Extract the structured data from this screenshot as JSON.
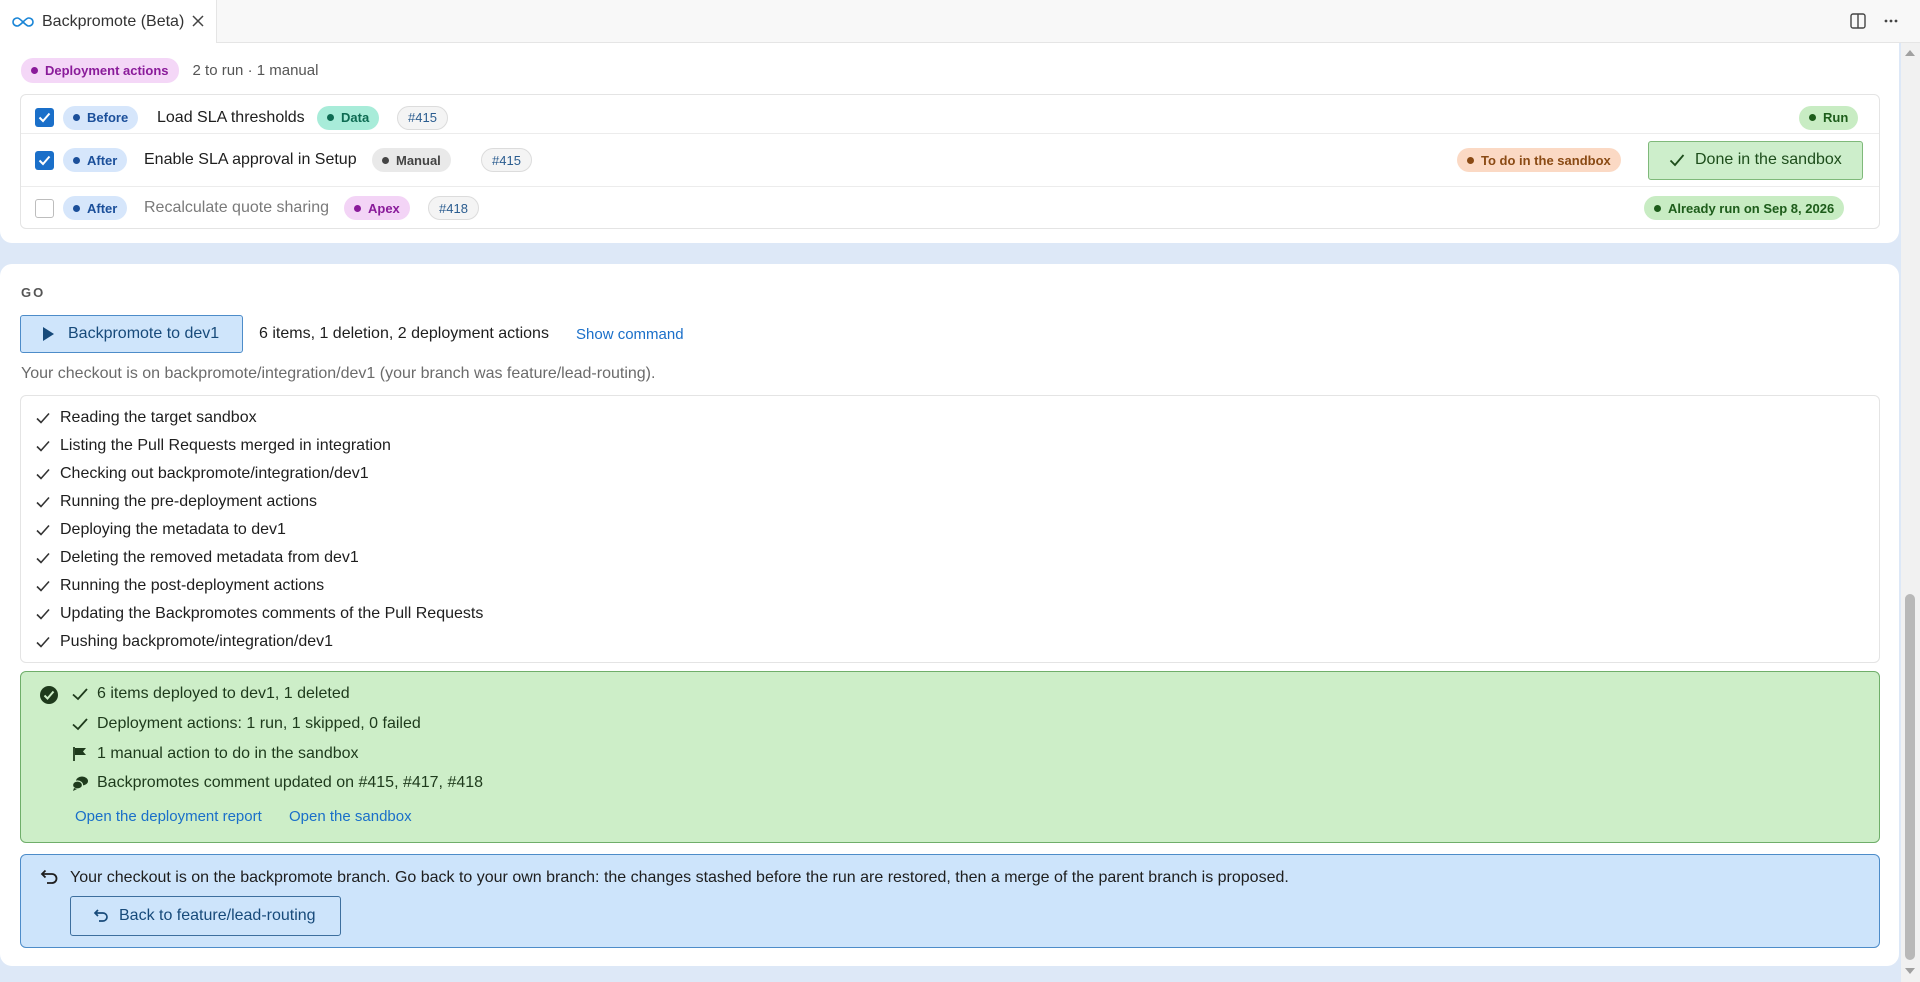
{
  "tab": {
    "title": "Backpromote (Beta)"
  },
  "deployment_actions": {
    "label": "Deployment actions",
    "summary": "2 to run · 1 manual",
    "rows": [
      {
        "checked": true,
        "phase": "Before",
        "title": "Load SLA thresholds",
        "kind": "Data",
        "pr": "#415",
        "status": "Run"
      },
      {
        "checked": true,
        "phase": "After",
        "title": "Enable SLA approval in Setup",
        "kind": "Manual",
        "pr": "#415",
        "status": "To do in the sandbox",
        "button": "Done in the sandbox"
      },
      {
        "checked": false,
        "phase": "After",
        "title": "Recalculate quote sharing",
        "kind": "Apex",
        "pr": "#418",
        "status": "Already run on Sep 8, 2026"
      }
    ]
  },
  "go": {
    "label": "GO",
    "button": "Backpromote to dev1",
    "summary": "6 items, 1 deletion, 2 deployment actions",
    "show_command": "Show command",
    "checkout_note": "Your checkout is on backpromote/integration/dev1 (your branch was feature/lead-routing).",
    "steps": [
      "Reading the target sandbox",
      "Listing the Pull Requests merged in integration",
      "Checking out backpromote/integration/dev1",
      "Running the pre-deployment actions",
      "Deploying the metadata to dev1",
      "Deleting the removed metadata from dev1",
      "Running the post-deployment actions",
      "Updating the Backpromotes comments of the Pull Requests",
      "Pushing backpromote/integration/dev1"
    ]
  },
  "result": {
    "lines": [
      "6 items deployed to dev1, 1 deleted",
      "Deployment actions: 1 run, 1 skipped, 0 failed",
      "1 manual action to do in the sandbox",
      "Backpromotes comment updated on #415, #417, #418"
    ],
    "links": [
      "Open the deployment report",
      "Open the sandbox"
    ]
  },
  "back": {
    "message": "Your checkout is on the backpromote branch. Go back to your own branch: the changes stashed before the run are restored, then a merge of the parent branch is proposed.",
    "button": "Back to feature/lead-routing"
  }
}
